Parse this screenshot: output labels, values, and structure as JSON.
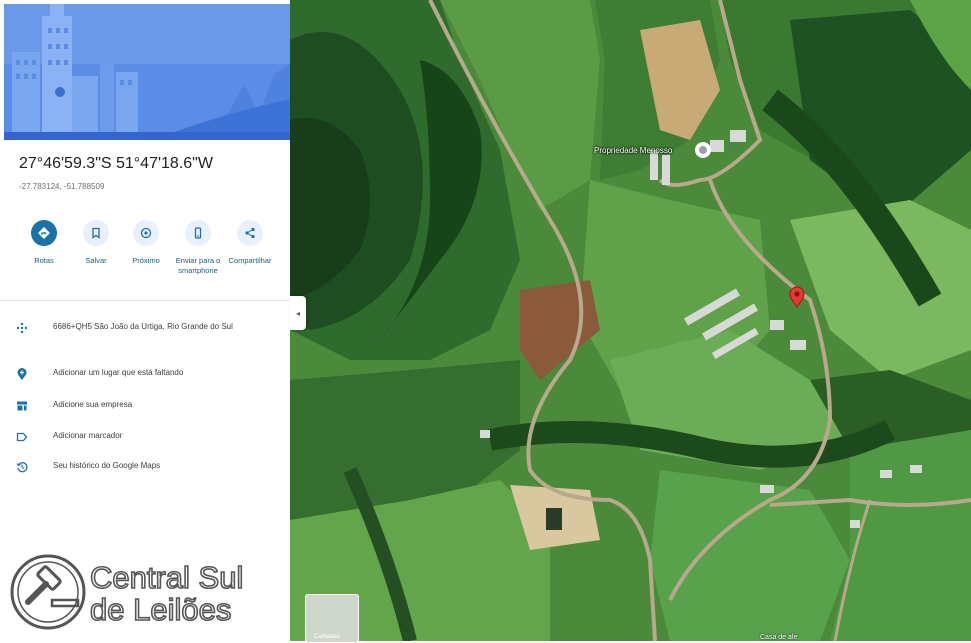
{
  "place": {
    "coords_dms": "27°46'59.3\"S 51°47'18.6\"W",
    "coords_decimal": "-27.783124, -51.788509"
  },
  "actions": [
    {
      "label": "Rotas",
      "icon": "directions-icon",
      "color": "#1a73a8",
      "filled": true
    },
    {
      "label": "Salvar",
      "icon": "bookmark-icon",
      "color": "#1a73a8",
      "filled": false
    },
    {
      "label": "Próximo",
      "icon": "nearby-icon",
      "color": "#1a73a8",
      "filled": false
    },
    {
      "label": "Enviar para o smartphone",
      "icon": "phone-icon",
      "color": "#1a73a8",
      "filled": false
    },
    {
      "label": "Compartilhar",
      "icon": "share-icon",
      "color": "#1a73a8",
      "filled": false
    }
  ],
  "details": [
    {
      "text": "6686+QH5 São João da Urtiga, Rio Grande do Sul",
      "icon": "plus-code-icon"
    },
    {
      "text": "Adicionar um lugar que está faltando",
      "icon": "add-place-icon"
    },
    {
      "text": "Adicione sua empresa",
      "icon": "business-icon"
    },
    {
      "text": "Adicionar marcador",
      "icon": "label-icon"
    },
    {
      "text": "Seu histórico do Google Maps",
      "icon": "history-icon"
    }
  ],
  "watermark": {
    "line1": "Central Sul",
    "line2": "de Leilões"
  },
  "map": {
    "place_label": "Propriedade Menosso",
    "layers_label": "Camadas",
    "bottom_label": "Casa de ale"
  },
  "colors": {
    "accent": "#1a73a8",
    "pin": "#e53935",
    "hero": "#5b8de6"
  }
}
